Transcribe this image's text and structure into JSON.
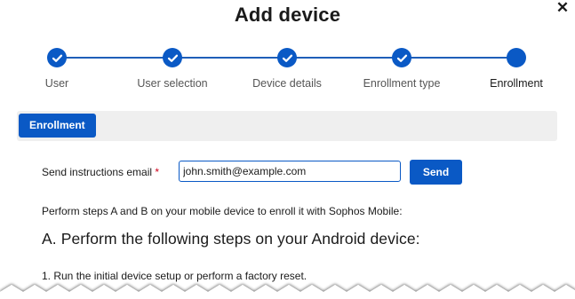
{
  "dialog": {
    "title": "Add device",
    "close_glyph": "✕"
  },
  "stepper": {
    "steps": [
      {
        "label": "User",
        "state": "completed"
      },
      {
        "label": "User selection",
        "state": "completed"
      },
      {
        "label": "Device details",
        "state": "completed"
      },
      {
        "label": "Enrollment type",
        "state": "completed"
      },
      {
        "label": "Enrollment",
        "state": "current"
      }
    ],
    "check_icon": "check-icon"
  },
  "tabs": [
    {
      "label": "Enrollment",
      "selected": true
    }
  ],
  "form": {
    "email_label": "Send instructions email",
    "required_marker": "*",
    "email_value": "john.smith@example.com",
    "send_label": "Send"
  },
  "content": {
    "instructions": "Perform steps A and B on your mobile device to enroll it with Sophos Mobile:",
    "heading_a": "A. Perform the following steps on your Android device:",
    "step_1": "1. Run the initial device setup or perform a factory reset."
  },
  "colors": {
    "accent": "#0a59c5",
    "required": "#d0021b",
    "tabbar_bg": "#efefef"
  }
}
